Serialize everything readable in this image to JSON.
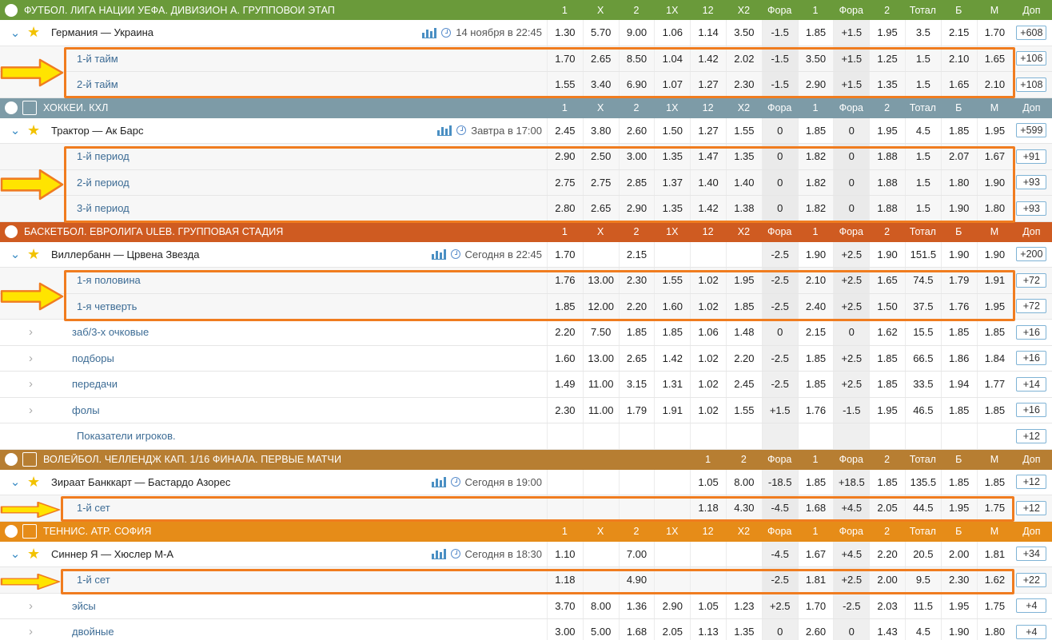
{
  "colors": {
    "football": "#6a9a3a",
    "hockey": "#7d9ba7",
    "basketball": "#cf5b21",
    "volleyball": "#b77e32",
    "tennis": "#e68c18",
    "highlight": "#f07c1f",
    "arrow": "#ffe400"
  },
  "sections": [
    {
      "icon": "football-icon",
      "title": "ФУТБОЛ. ЛИГА НАЦИИ УЕФА. ДИВИЗИОН А. ГРУППОВОИ ЭТАП",
      "cols": [
        "1",
        "X",
        "2",
        "1X",
        "12",
        "X2",
        "Фора",
        "1",
        "Фора",
        "2",
        "Тотал",
        "Б",
        "М"
      ],
      "dop": "Доп",
      "match": {
        "name": "Германия — Украина",
        "time": "14 ноября в 22:45",
        "odds": [
          "1.30",
          "5.70",
          "9.00",
          "1.06",
          "1.14",
          "3.50",
          "-1.5",
          "1.85",
          "+1.5",
          "1.95",
          "3.5",
          "2.15",
          "1.70"
        ],
        "more": "+608"
      },
      "subs": [
        {
          "label": "1-й тайм",
          "odds": [
            "1.70",
            "2.65",
            "8.50",
            "1.04",
            "1.42",
            "2.02",
            "-1.5",
            "3.50",
            "+1.5",
            "1.25",
            "1.5",
            "2.10",
            "1.65"
          ],
          "more": "+106"
        },
        {
          "label": "2-й тайм",
          "odds": [
            "1.55",
            "3.40",
            "6.90",
            "1.07",
            "1.27",
            "2.30",
            "-1.5",
            "2.90",
            "+1.5",
            "1.35",
            "1.5",
            "1.65",
            "2.10"
          ],
          "more": "+108"
        }
      ]
    },
    {
      "icon": "hockey-icon",
      "title": "ХОККЕИ. КХЛ",
      "cols": [
        "1",
        "X",
        "2",
        "1X",
        "12",
        "X2",
        "Фора",
        "1",
        "Фора",
        "2",
        "Тотал",
        "Б",
        "М"
      ],
      "dop": "Доп",
      "match": {
        "name": "Трактор — Ак Барс",
        "time": "Завтра в 17:00",
        "odds": [
          "2.45",
          "3.80",
          "2.60",
          "1.50",
          "1.27",
          "1.55",
          "0",
          "1.85",
          "0",
          "1.95",
          "4.5",
          "1.85",
          "1.95"
        ],
        "more": "+599"
      },
      "subs": [
        {
          "label": "1-й период",
          "odds": [
            "2.90",
            "2.50",
            "3.00",
            "1.35",
            "1.47",
            "1.35",
            "0",
            "1.82",
            "0",
            "1.88",
            "1.5",
            "2.07",
            "1.67"
          ],
          "more": "+91"
        },
        {
          "label": "2-й период",
          "odds": [
            "2.75",
            "2.75",
            "2.85",
            "1.37",
            "1.40",
            "1.40",
            "0",
            "1.82",
            "0",
            "1.88",
            "1.5",
            "1.80",
            "1.90"
          ],
          "more": "+93"
        },
        {
          "label": "3-й период",
          "odds": [
            "2.80",
            "2.65",
            "2.90",
            "1.35",
            "1.42",
            "1.38",
            "0",
            "1.82",
            "0",
            "1.88",
            "1.5",
            "1.90",
            "1.80"
          ],
          "more": "+93"
        }
      ]
    },
    {
      "icon": "basketball-icon",
      "title": "БАСКЕТБОЛ. ЕВРОЛИГА ULEB. ГРУППОВАЯ СТАДИЯ",
      "cols": [
        "1",
        "X",
        "2",
        "1X",
        "12",
        "X2",
        "Фора",
        "1",
        "Фора",
        "2",
        "Тотал",
        "Б",
        "М"
      ],
      "dop": "Доп",
      "match": {
        "name": "Виллербанн — Црвена Звезда",
        "time": "Сегодня в 22:45",
        "odds": [
          "1.70",
          "",
          "2.15",
          "",
          "",
          "",
          "-2.5",
          "1.90",
          "+2.5",
          "1.90",
          "151.5",
          "1.90",
          "1.90"
        ],
        "more": "+200"
      },
      "subs": [
        {
          "label": "1-я половина",
          "odds": [
            "1.76",
            "13.00",
            "2.30",
            "1.55",
            "1.02",
            "1.95",
            "-2.5",
            "2.10",
            "+2.5",
            "1.65",
            "74.5",
            "1.79",
            "1.91"
          ],
          "more": "+72"
        },
        {
          "label": "1-я четверть",
          "odds": [
            "1.85",
            "12.00",
            "2.20",
            "1.60",
            "1.02",
            "1.85",
            "-2.5",
            "2.40",
            "+2.5",
            "1.50",
            "37.5",
            "1.76",
            "1.95"
          ],
          "more": "+72"
        }
      ],
      "extras": [
        {
          "label": "заб/3-х очковые",
          "odds": [
            "2.20",
            "7.50",
            "1.85",
            "1.85",
            "1.06",
            "1.48",
            "0",
            "2.15",
            "0",
            "1.62",
            "15.5",
            "1.85",
            "1.85"
          ],
          "more": "+16"
        },
        {
          "label": "подборы",
          "odds": [
            "1.60",
            "13.00",
            "2.65",
            "1.42",
            "1.02",
            "2.20",
            "-2.5",
            "1.85",
            "+2.5",
            "1.85",
            "66.5",
            "1.86",
            "1.84"
          ],
          "more": "+16"
        },
        {
          "label": "передачи",
          "odds": [
            "1.49",
            "11.00",
            "3.15",
            "1.31",
            "1.02",
            "2.45",
            "-2.5",
            "1.85",
            "+2.5",
            "1.85",
            "33.5",
            "1.94",
            "1.77"
          ],
          "more": "+14"
        },
        {
          "label": "фолы",
          "odds": [
            "2.30",
            "11.00",
            "1.79",
            "1.91",
            "1.02",
            "1.55",
            "+1.5",
            "1.76",
            "-1.5",
            "1.95",
            "46.5",
            "1.85",
            "1.85"
          ],
          "more": "+16"
        }
      ],
      "players": {
        "label": "Показатели игроков.",
        "more": "+12"
      }
    },
    {
      "icon": "volleyball-icon",
      "title": "ВОЛЕЙБОЛ. ЧЕЛЛЕНДЖ КАП. 1/16 ФИНАЛА. ПЕРВЫЕ МАТЧИ",
      "cols": [
        "",
        "",
        "",
        "",
        "1",
        "2",
        "Фора",
        "1",
        "Фора",
        "2",
        "Тотал",
        "Б",
        "М"
      ],
      "dop": "Доп",
      "match": {
        "name": "Зираат Банккарт — Бастардо Азорес",
        "time": "Сегодня в 19:00",
        "odds": [
          "",
          "",
          "",
          "",
          "1.05",
          "8.00",
          "-18.5",
          "1.85",
          "+18.5",
          "1.85",
          "135.5",
          "1.85",
          "1.85"
        ],
        "more": "+12"
      },
      "subs": [
        {
          "label": "1-й сет",
          "odds": [
            "",
            "",
            "",
            "",
            "1.18",
            "4.30",
            "-4.5",
            "1.68",
            "+4.5",
            "2.05",
            "44.5",
            "1.95",
            "1.75"
          ],
          "more": "+12"
        }
      ]
    },
    {
      "icon": "tennis-icon",
      "title": "ТЕННИС. ATP. СОФИЯ",
      "cols": [
        "1",
        "X",
        "2",
        "1X",
        "12",
        "X2",
        "Фора",
        "1",
        "Фора",
        "2",
        "Тотал",
        "Б",
        "М"
      ],
      "dop": "Доп",
      "match": {
        "name": "Синнер Я — Хюслер М-А",
        "time": "Сегодня в 18:30",
        "odds": [
          "1.10",
          "",
          "7.00",
          "",
          "",
          "",
          "-4.5",
          "1.67",
          "+4.5",
          "2.20",
          "20.5",
          "2.00",
          "1.81"
        ],
        "more": "+34"
      },
      "subs": [
        {
          "label": "1-й сет",
          "odds": [
            "1.18",
            "",
            "4.90",
            "",
            "",
            "",
            "-2.5",
            "1.81",
            "+2.5",
            "2.00",
            "9.5",
            "2.30",
            "1.62"
          ],
          "more": "+22"
        }
      ],
      "extras": [
        {
          "label": "эйсы",
          "odds": [
            "3.70",
            "8.00",
            "1.36",
            "2.90",
            "1.05",
            "1.23",
            "+2.5",
            "1.70",
            "-2.5",
            "2.03",
            "11.5",
            "1.95",
            "1.75"
          ],
          "more": "+4"
        },
        {
          "label": "двойные",
          "odds": [
            "3.00",
            "5.00",
            "1.68",
            "2.05",
            "1.13",
            "1.35",
            "0",
            "2.60",
            "0",
            "1.43",
            "4.5",
            "1.90",
            "1.80"
          ],
          "more": "+4"
        }
      ]
    }
  ]
}
